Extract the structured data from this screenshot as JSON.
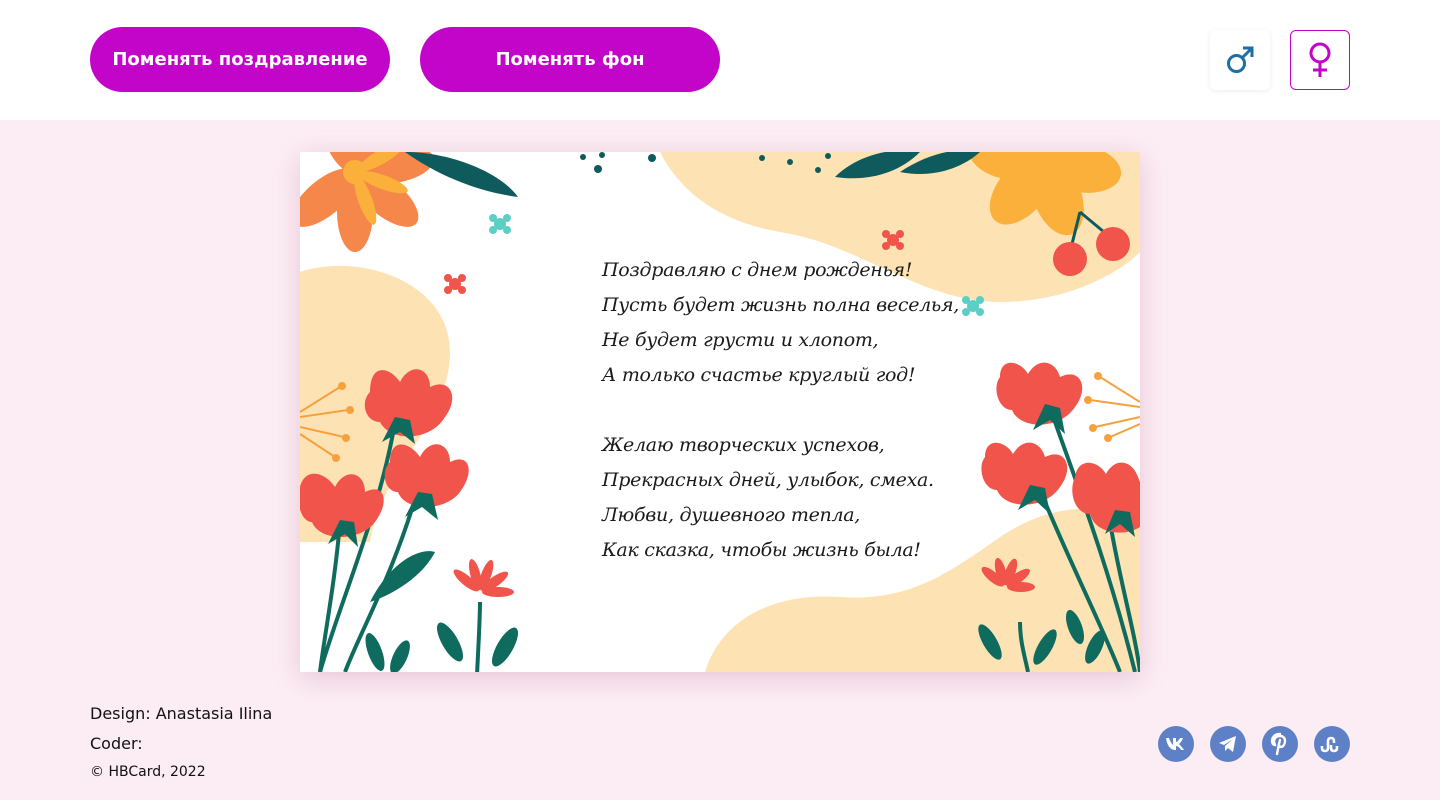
{
  "header": {
    "change_greeting_label": "Поменять поздравление",
    "change_background_label": "Поменять фон",
    "male_symbol": "♂",
    "female_symbol": "♀",
    "accent_color": "#c205c8",
    "male_color": "#1a6fa8"
  },
  "card": {
    "poem_stanza_1": [
      "Поздравляю с днем рожденья!",
      "Пусть будет жизнь полна веселья,",
      "Не будет грусти и хлопот,",
      "А только счастье круглый год!"
    ],
    "poem_stanza_2": [
      "Желаю творческих успехов,",
      "Прекрасных дней, улыбок, смеха.",
      "Любви, душевного тепла,",
      "Как сказка, чтобы жизнь была!"
    ]
  },
  "footer": {
    "design": "Design: Anastasia Ilina",
    "coder": "Coder:",
    "copyright": "© HBCard, 2022",
    "social": [
      "vk-icon",
      "telegram-icon",
      "pinterest-icon",
      "stumbleupon-icon"
    ],
    "social_color": "#5d80c7"
  }
}
